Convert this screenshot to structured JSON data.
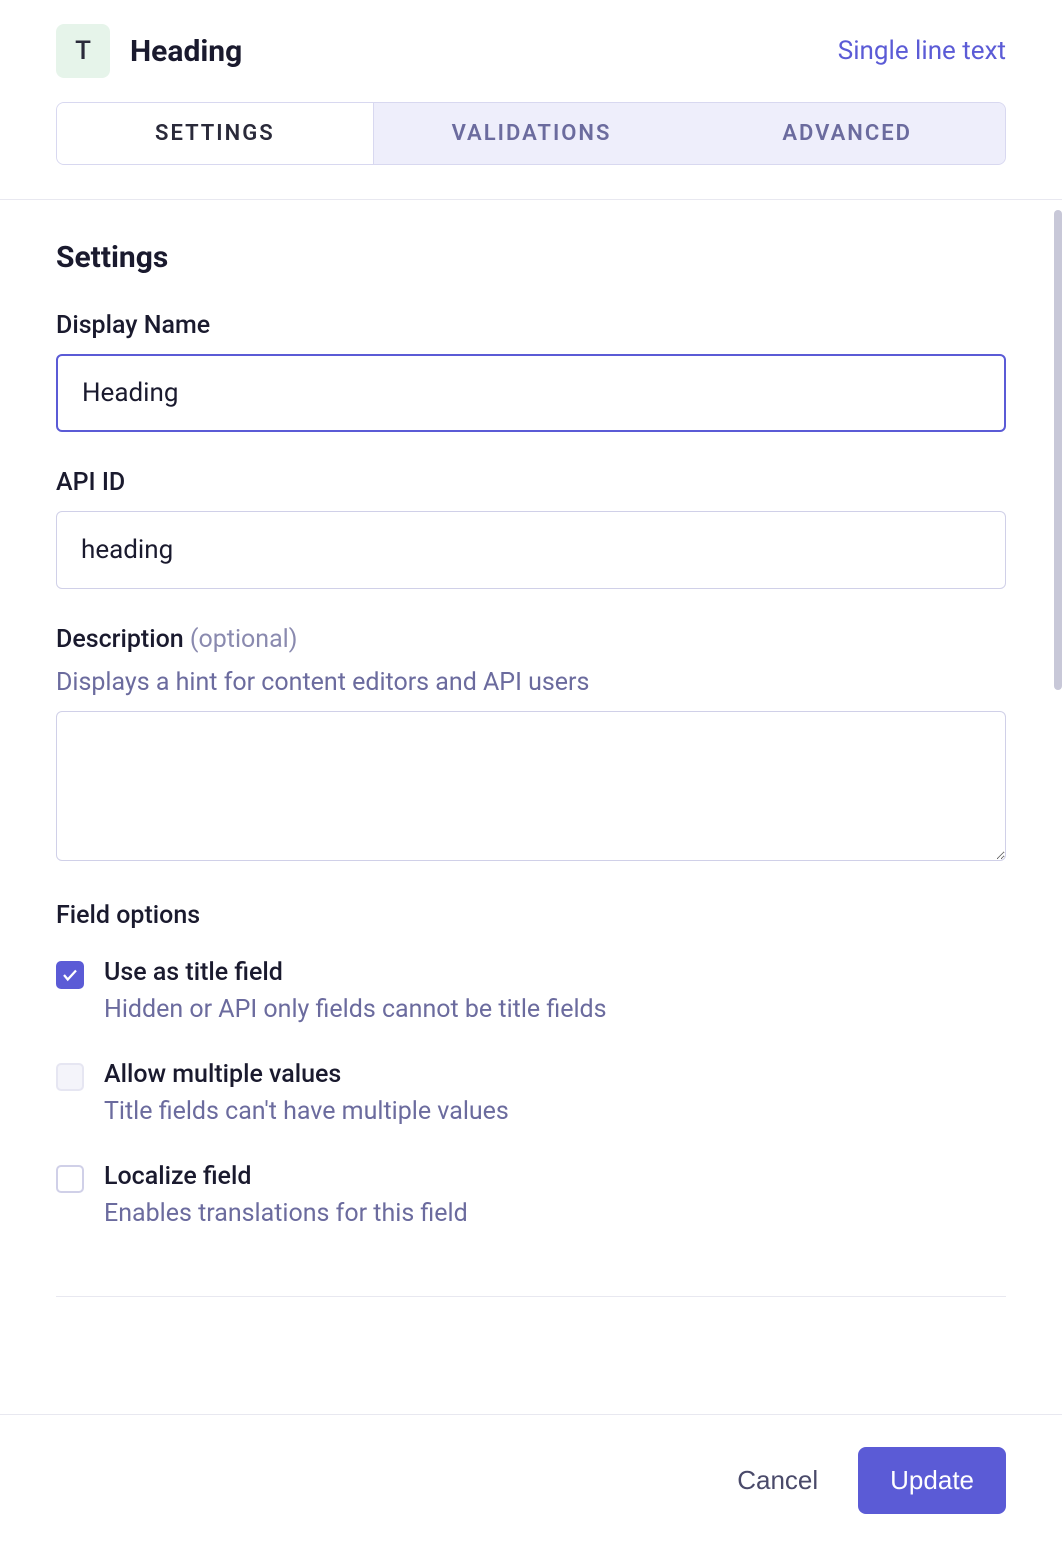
{
  "header": {
    "icon_letter": "T",
    "title": "Heading",
    "type_label": "Single line text"
  },
  "tabs": [
    {
      "label": "Settings",
      "active": true
    },
    {
      "label": "Validations",
      "active": false
    },
    {
      "label": "Advanced",
      "active": false
    }
  ],
  "section_title": "Settings",
  "fields": {
    "display_name": {
      "label": "Display Name",
      "value": "Heading"
    },
    "api_id": {
      "label": "API ID",
      "value": "heading"
    },
    "description": {
      "label": "Description",
      "optional_label": "(optional)",
      "hint": "Displays a hint for content editors and API users",
      "value": ""
    }
  },
  "field_options": {
    "title": "Field options",
    "items": [
      {
        "label": "Use as title field",
        "hint": "Hidden or API only fields cannot be title fields",
        "checked": true,
        "disabled": false
      },
      {
        "label": "Allow multiple values",
        "hint": "Title fields can't have multiple values",
        "checked": false,
        "disabled": true
      },
      {
        "label": "Localize field",
        "hint": "Enables translations for this field",
        "checked": false,
        "disabled": false
      }
    ]
  },
  "footer": {
    "cancel": "Cancel",
    "update": "Update"
  }
}
